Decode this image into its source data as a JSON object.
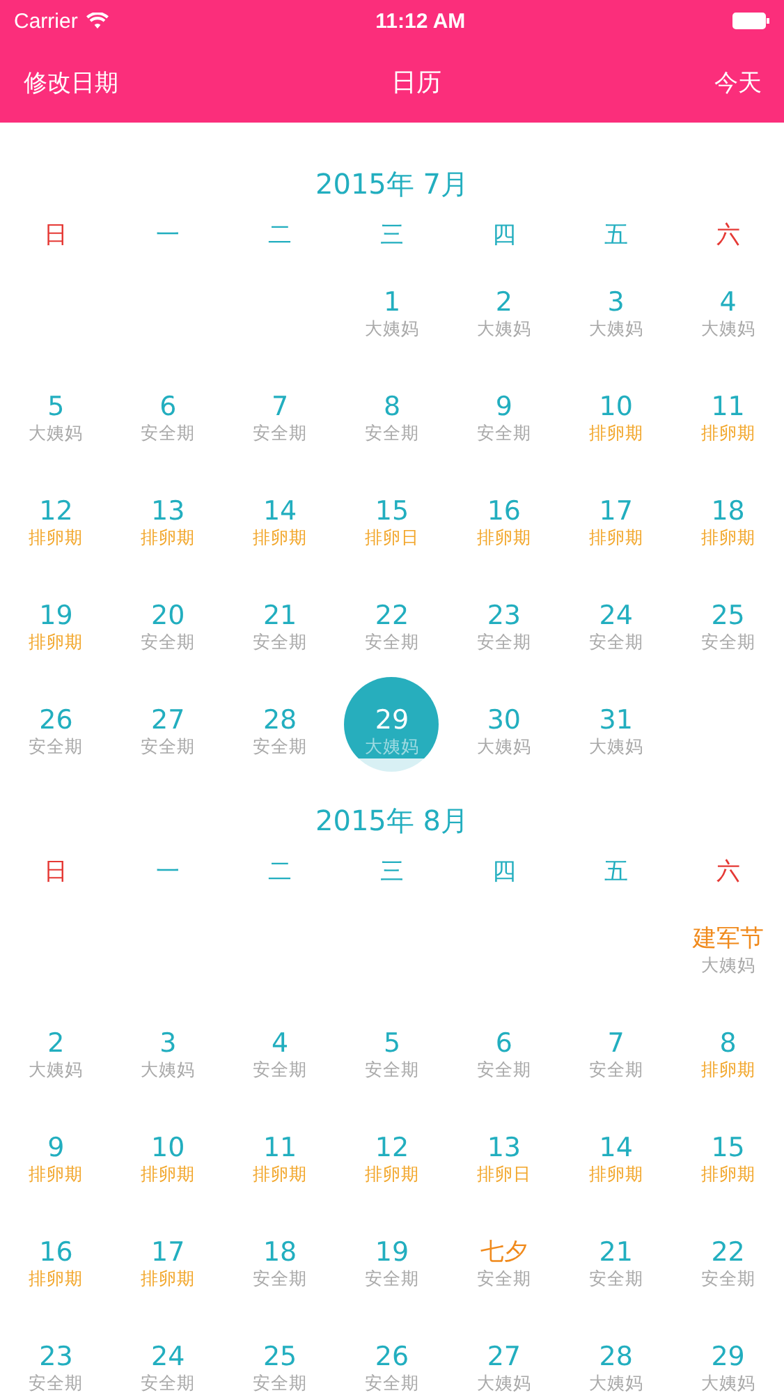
{
  "status_bar": {
    "carrier": "Carrier",
    "time": "11:12 AM"
  },
  "nav_bar": {
    "left": "修改日期",
    "title": "日历",
    "right": "今天"
  },
  "months": [
    {
      "title": "2015年 7月",
      "weekdays": [
        {
          "label": "日",
          "weekend": true
        },
        {
          "label": "一",
          "weekend": false
        },
        {
          "label": "二",
          "weekend": false
        },
        {
          "label": "三",
          "weekend": false
        },
        {
          "label": "四",
          "weekend": false
        },
        {
          "label": "五",
          "weekend": false
        },
        {
          "label": "六",
          "weekend": true
        }
      ],
      "weeks": [
        {
          "right_aligned": true,
          "days": [
            {
              "day": "1",
              "note": "大姨妈",
              "fertile": false,
              "festival": false,
              "selected": false
            },
            {
              "day": "2",
              "note": "大姨妈",
              "fertile": false,
              "festival": false,
              "selected": false
            },
            {
              "day": "3",
              "note": "大姨妈",
              "fertile": false,
              "festival": false,
              "selected": false
            },
            {
              "day": "4",
              "note": "大姨妈",
              "fertile": false,
              "festival": false,
              "selected": false
            }
          ]
        },
        {
          "days": [
            {
              "day": "5",
              "note": "大姨妈",
              "fertile": false,
              "festival": false,
              "selected": false
            },
            {
              "day": "6",
              "note": "安全期",
              "fertile": false,
              "festival": false,
              "selected": false
            },
            {
              "day": "7",
              "note": "安全期",
              "fertile": false,
              "festival": false,
              "selected": false
            },
            {
              "day": "8",
              "note": "安全期",
              "fertile": false,
              "festival": false,
              "selected": false
            },
            {
              "day": "9",
              "note": "安全期",
              "fertile": false,
              "festival": false,
              "selected": false
            },
            {
              "day": "10",
              "note": "排卵期",
              "fertile": true,
              "festival": false,
              "selected": false
            },
            {
              "day": "11",
              "note": "排卵期",
              "fertile": true,
              "festival": false,
              "selected": false
            }
          ]
        },
        {
          "days": [
            {
              "day": "12",
              "note": "排卵期",
              "fertile": true,
              "festival": false,
              "selected": false
            },
            {
              "day": "13",
              "note": "排卵期",
              "fertile": true,
              "festival": false,
              "selected": false
            },
            {
              "day": "14",
              "note": "排卵期",
              "fertile": true,
              "festival": false,
              "selected": false
            },
            {
              "day": "15",
              "note": "排卵日",
              "fertile": true,
              "festival": false,
              "selected": false
            },
            {
              "day": "16",
              "note": "排卵期",
              "fertile": true,
              "festival": false,
              "selected": false
            },
            {
              "day": "17",
              "note": "排卵期",
              "fertile": true,
              "festival": false,
              "selected": false
            },
            {
              "day": "18",
              "note": "排卵期",
              "fertile": true,
              "festival": false,
              "selected": false
            }
          ]
        },
        {
          "days": [
            {
              "day": "19",
              "note": "排卵期",
              "fertile": true,
              "festival": false,
              "selected": false
            },
            {
              "day": "20",
              "note": "安全期",
              "fertile": false,
              "festival": false,
              "selected": false
            },
            {
              "day": "21",
              "note": "安全期",
              "fertile": false,
              "festival": false,
              "selected": false
            },
            {
              "day": "22",
              "note": "安全期",
              "fertile": false,
              "festival": false,
              "selected": false
            },
            {
              "day": "23",
              "note": "安全期",
              "fertile": false,
              "festival": false,
              "selected": false
            },
            {
              "day": "24",
              "note": "安全期",
              "fertile": false,
              "festival": false,
              "selected": false
            },
            {
              "day": "25",
              "note": "安全期",
              "fertile": false,
              "festival": false,
              "selected": false
            }
          ]
        },
        {
          "right_aligned": false,
          "days": [
            {
              "day": "26",
              "note": "安全期",
              "fertile": false,
              "festival": false,
              "selected": false
            },
            {
              "day": "27",
              "note": "安全期",
              "fertile": false,
              "festival": false,
              "selected": false
            },
            {
              "day": "28",
              "note": "安全期",
              "fertile": false,
              "festival": false,
              "selected": false
            },
            {
              "day": "29",
              "note": "大姨妈",
              "fertile": false,
              "festival": false,
              "selected": true
            },
            {
              "day": "30",
              "note": "大姨妈",
              "fertile": false,
              "festival": false,
              "selected": false
            },
            {
              "day": "31",
              "note": "大姨妈",
              "fertile": false,
              "festival": false,
              "selected": false
            }
          ]
        }
      ]
    },
    {
      "title": "2015年 8月",
      "weekdays": [
        {
          "label": "日",
          "weekend": true
        },
        {
          "label": "一",
          "weekend": false
        },
        {
          "label": "二",
          "weekend": false
        },
        {
          "label": "三",
          "weekend": false
        },
        {
          "label": "四",
          "weekend": false
        },
        {
          "label": "五",
          "weekend": false
        },
        {
          "label": "六",
          "weekend": true
        }
      ],
      "weeks": [
        {
          "right_aligned": true,
          "days": [
            {
              "day": "建军节",
              "note": "大姨妈",
              "fertile": false,
              "festival": true,
              "selected": false
            }
          ]
        },
        {
          "days": [
            {
              "day": "2",
              "note": "大姨妈",
              "fertile": false,
              "festival": false,
              "selected": false
            },
            {
              "day": "3",
              "note": "大姨妈",
              "fertile": false,
              "festival": false,
              "selected": false
            },
            {
              "day": "4",
              "note": "安全期",
              "fertile": false,
              "festival": false,
              "selected": false
            },
            {
              "day": "5",
              "note": "安全期",
              "fertile": false,
              "festival": false,
              "selected": false
            },
            {
              "day": "6",
              "note": "安全期",
              "fertile": false,
              "festival": false,
              "selected": false
            },
            {
              "day": "7",
              "note": "安全期",
              "fertile": false,
              "festival": false,
              "selected": false
            },
            {
              "day": "8",
              "note": "排卵期",
              "fertile": true,
              "festival": false,
              "selected": false
            }
          ]
        },
        {
          "days": [
            {
              "day": "9",
              "note": "排卵期",
              "fertile": true,
              "festival": false,
              "selected": false
            },
            {
              "day": "10",
              "note": "排卵期",
              "fertile": true,
              "festival": false,
              "selected": false
            },
            {
              "day": "11",
              "note": "排卵期",
              "fertile": true,
              "festival": false,
              "selected": false
            },
            {
              "day": "12",
              "note": "排卵期",
              "fertile": true,
              "festival": false,
              "selected": false
            },
            {
              "day": "13",
              "note": "排卵日",
              "fertile": true,
              "festival": false,
              "selected": false
            },
            {
              "day": "14",
              "note": "排卵期",
              "fertile": true,
              "festival": false,
              "selected": false
            },
            {
              "day": "15",
              "note": "排卵期",
              "fertile": true,
              "festival": false,
              "selected": false
            }
          ]
        },
        {
          "days": [
            {
              "day": "16",
              "note": "排卵期",
              "fertile": true,
              "festival": false,
              "selected": false
            },
            {
              "day": "17",
              "note": "排卵期",
              "fertile": true,
              "festival": false,
              "selected": false
            },
            {
              "day": "18",
              "note": "安全期",
              "fertile": false,
              "festival": false,
              "selected": false
            },
            {
              "day": "19",
              "note": "安全期",
              "fertile": false,
              "festival": false,
              "selected": false
            },
            {
              "day": "七夕",
              "note": "安全期",
              "fertile": false,
              "festival": true,
              "selected": false
            },
            {
              "day": "21",
              "note": "安全期",
              "fertile": false,
              "festival": false,
              "selected": false
            },
            {
              "day": "22",
              "note": "安全期",
              "fertile": false,
              "festival": false,
              "selected": false
            }
          ]
        },
        {
          "days": [
            {
              "day": "23",
              "note": "安全期",
              "fertile": false,
              "festival": false,
              "selected": false
            },
            {
              "day": "24",
              "note": "安全期",
              "fertile": false,
              "festival": false,
              "selected": false
            },
            {
              "day": "25",
              "note": "安全期",
              "fertile": false,
              "festival": false,
              "selected": false
            },
            {
              "day": "26",
              "note": "安全期",
              "fertile": false,
              "festival": false,
              "selected": false
            },
            {
              "day": "27",
              "note": "大姨妈",
              "fertile": false,
              "festival": false,
              "selected": false
            },
            {
              "day": "28",
              "note": "大姨妈",
              "fertile": false,
              "festival": false,
              "selected": false
            },
            {
              "day": "29",
              "note": "大姨妈",
              "fertile": false,
              "festival": false,
              "selected": false
            }
          ]
        }
      ]
    }
  ]
}
